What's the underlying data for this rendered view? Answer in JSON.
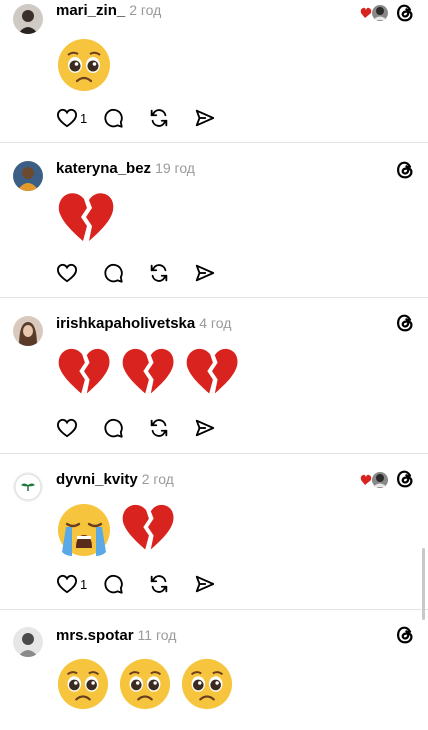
{
  "posts": [
    {
      "username": "mari_zin_",
      "time": "2 год",
      "emojis": [
        "pleading-face"
      ],
      "likes": "1",
      "has_reply_badge": true
    },
    {
      "username": "kateryna_bez",
      "time": "19 год",
      "emojis": [
        "broken-heart"
      ],
      "likes": "",
      "has_reply_badge": false
    },
    {
      "username": "irishkapaholivetska",
      "time": "4 год",
      "emojis": [
        "broken-heart",
        "broken-heart",
        "broken-heart"
      ],
      "likes": "",
      "has_reply_badge": false
    },
    {
      "username": "dyvni_kvity",
      "time": "2 год",
      "emojis": [
        "crying-face",
        "broken-heart"
      ],
      "likes": "1",
      "has_reply_badge": true
    },
    {
      "username": "mrs.spotar",
      "time": "11 год",
      "emojis": [
        "pleading-face",
        "pleading-face",
        "pleading-face"
      ],
      "likes": "",
      "has_reply_badge": false
    }
  ],
  "icons": {
    "like": "heart-icon",
    "reply": "comment-icon",
    "repost": "repost-icon",
    "share": "share-icon",
    "brand": "threads-logo-icon"
  },
  "colors": {
    "time": "#9a9a9a",
    "divider": "#e3e3e3",
    "heart_red": "#d9231f",
    "emoji_yellow": "#f7c53d"
  }
}
